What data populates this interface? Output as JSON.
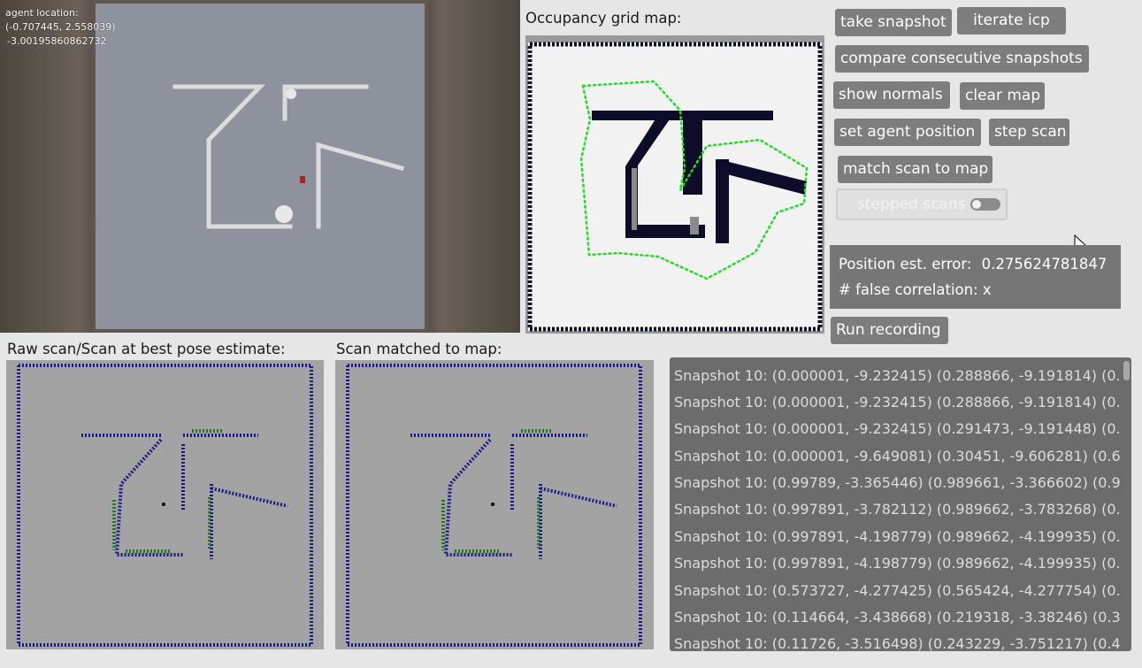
{
  "sim_view": {
    "agent_location_label": "agent location:",
    "agent_location_value": "(-0.707445, 2.558039)",
    "agent_heading": "-3.00195860862732"
  },
  "occupancy": {
    "title": "Occupancy grid map:"
  },
  "buttons": {
    "take_snapshot": "take snapshot",
    "iterate_icp": "iterate icp",
    "compare": "compare consecutive snapshots",
    "show_normals": "show normals",
    "clear_map": "clear map",
    "set_agent_position": "set agent position",
    "step_scan": "step scan",
    "match_scan": "match scan to map",
    "stepped_scans": "stepped scans",
    "run_recording": "Run recording"
  },
  "toggle": {
    "stepped_scans_on": false
  },
  "error_panel": {
    "position_label": "Position est. error:",
    "position_value": "0.275624781847",
    "false_corr": "# false correlation: x"
  },
  "raw_scan": {
    "title": "Raw scan/Scan at best pose estimate:"
  },
  "matched_scan": {
    "title": "Scan matched to map:"
  },
  "log": {
    "rows": [
      "Snapshot 10: (0.000001, -9.232415) (0.288866, -9.191814) (0.",
      "Snapshot 10: (0.000001, -9.232415) (0.288866, -9.191814) (0.",
      "Snapshot 10: (0.000001, -9.232415) (0.291473, -9.191448) (0.",
      "Snapshot 10: (0.000001, -9.649081) (0.30451, -9.606281) (0.6",
      "Snapshot 10: (0.99789, -3.365446) (0.989661, -3.366602) (0.9",
      "Snapshot 10: (0.997891, -3.782112) (0.989662, -3.783268) (0.",
      "Snapshot 10: (0.997891, -4.198779) (0.989662, -4.199935) (0.",
      "Snapshot 10: (0.997891, -4.198779) (0.989662, -4.199935) (0.",
      "Snapshot 10: (0.573727, -4.277425) (0.565424, -4.277754) (0.",
      "Snapshot 10: (0.114664, -3.438668) (0.219318, -3.38246) (0.3",
      "Snapshot 10: (0.11726, -3.516498) (0.243229, -3.751217) (0.4"
    ]
  },
  "colors": {
    "button_bg": "#7d7d7d",
    "scan_point": "#1a1a8a",
    "matched_point": "#1f7a1f",
    "path_green": "#22dd22",
    "map_obstacle": "#0d0d2a"
  }
}
